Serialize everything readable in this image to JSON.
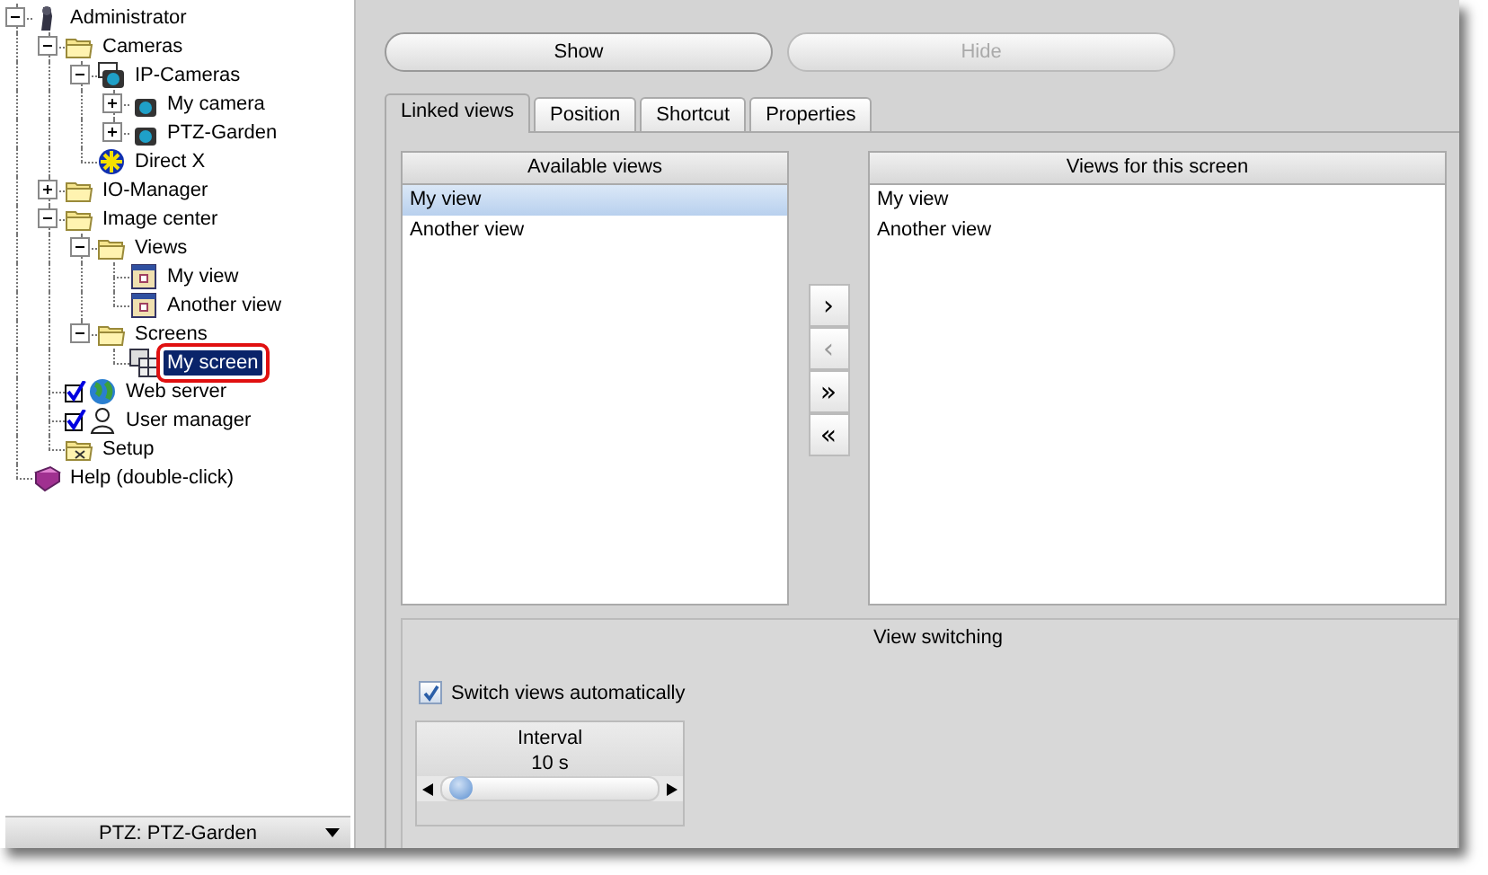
{
  "tree": [
    {
      "label": "Administrator",
      "kind": "admin",
      "expanded": true,
      "children": [
        {
          "label": "Cameras",
          "kind": "folder",
          "expanded": true,
          "children": [
            {
              "label": "IP-Cameras",
              "kind": "ipcams",
              "expanded": true,
              "children": [
                {
                  "label": "My camera",
                  "kind": "camera",
                  "expanded": false
                },
                {
                  "label": "PTZ-Garden",
                  "kind": "camera",
                  "expanded": false
                }
              ]
            },
            {
              "label": "Direct X",
              "kind": "directx"
            }
          ]
        },
        {
          "label": "IO-Manager",
          "kind": "folder",
          "expanded": false
        },
        {
          "label": "Image center",
          "kind": "folder",
          "expanded": true,
          "children": [
            {
              "label": "Views",
              "kind": "folder",
              "expanded": true,
              "children": [
                {
                  "label": "My view",
                  "kind": "view",
                  "selected": false
                },
                {
                  "label": "Another view",
                  "kind": "view",
                  "selected": false
                }
              ]
            },
            {
              "label": "Screens",
              "kind": "folder",
              "expanded": true,
              "children": [
                {
                  "label": "My screen",
                  "kind": "screen",
                  "selected": true
                }
              ]
            }
          ]
        },
        {
          "label": "Web server",
          "kind": "globe",
          "checked": true
        },
        {
          "label": "User manager",
          "kind": "user",
          "checked": true
        },
        {
          "label": "Setup",
          "kind": "setup"
        }
      ]
    },
    {
      "label": "Help (double-click)",
      "kind": "help"
    }
  ],
  "ptz_dropdown": {
    "value": "PTZ: PTZ-Garden"
  },
  "buttons": [
    {
      "label": "Show",
      "disabled": false
    },
    {
      "label": "Hide",
      "disabled": true
    }
  ],
  "tabs": [
    {
      "label": "Linked views",
      "selected": true
    },
    {
      "label": "Position",
      "selected": false
    },
    {
      "label": "Shortcut",
      "selected": false
    },
    {
      "label": "Properties",
      "selected": false
    }
  ],
  "available_views": {
    "title": "Available views",
    "items": [
      {
        "label": "My view",
        "selected": true
      },
      {
        "label": "Another view",
        "selected": false
      }
    ]
  },
  "move_buttons": [
    {
      "symbol": "›",
      "disabled": false
    },
    {
      "symbol": "‹",
      "disabled": true
    },
    {
      "symbol": "»",
      "disabled": false
    },
    {
      "symbol": "«",
      "disabled": false
    }
  ],
  "screen_views": {
    "title": "Views for this screen",
    "items": [
      {
        "label": "My view",
        "selected": false
      },
      {
        "label": "Another view",
        "selected": false
      }
    ]
  },
  "view_switching": {
    "title": "View switching",
    "auto_switch": {
      "label": "Switch views automatically",
      "checked": true
    },
    "interval": {
      "label": "Interval",
      "reading": "10 s",
      "level": 0.03
    }
  }
}
